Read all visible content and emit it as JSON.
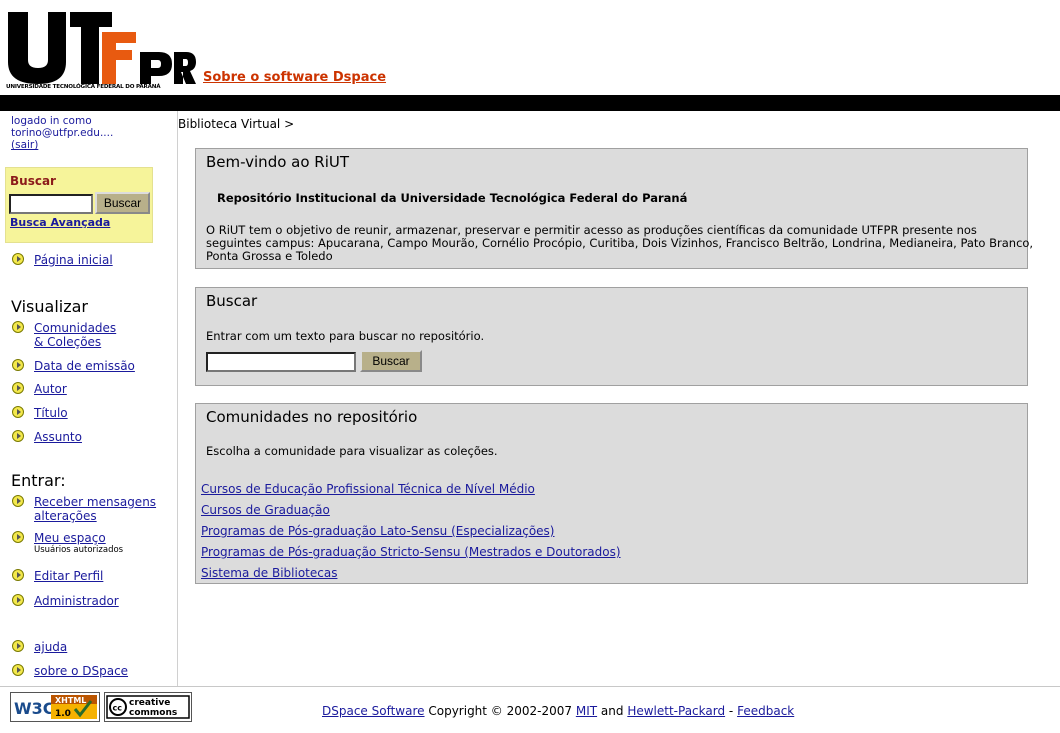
{
  "header": {
    "logo_text": "UTFPR",
    "logo_subtitle": "UNIVERSIDADE TECNOLÓGICA FEDERAL DO PARANÁ",
    "about_link": "Sobre o software Dspace"
  },
  "sidebar": {
    "login_line1": "logado in como",
    "login_line2": "torino@utfpr.edu....",
    "logout": "(sair)",
    "search_title": "Buscar",
    "search_button": "Buscar",
    "search_value": "",
    "advanced_search": "Busca Avançada",
    "home": "Página inicial",
    "browse_title": "Visualizar",
    "browse_items": [
      "Comunidades",
      "& Coleções",
      "Data de emissão",
      "Autor",
      "Título",
      "Assunto"
    ],
    "login_title": "Entrar:",
    "receive_1": "Receber mensagens",
    "receive_2": "alterações",
    "myspace": "Meu espaço",
    "myspace_note": "Usuários autorizados",
    "edit_profile": "Editar Perfil",
    "admin": "Administrador",
    "help": "ajuda",
    "about_dspace": "sobre o DSpace"
  },
  "main": {
    "breadcrumb": "Biblioteca Virtual >",
    "welcome_title": "Bem-vindo ao RiUT",
    "welcome_subtitle": "Repositório Institucional da Universidade Tecnológica Federal do Paraná",
    "welcome_text": "O RiUT tem o objetivo de reunir, armazenar, preservar e permitir acesso as produções científicas da comunidade UTFPR presente nos seguintes campus: Apucarana, Campo Mourão, Cornélio Procópio, Curitiba, Dois Vizinhos, Francisco Beltrão, Londrina, Medianeira, Pato Branco, Ponta Grossa e Toledo",
    "search_title": "Buscar",
    "search_text": "Entrar com um texto para buscar no repositório.",
    "search_button": "Buscar",
    "search_value": "",
    "communities_title": "Comunidades no repositório",
    "communities_text": "Escolha a comunidade para visualizar as coleções.",
    "communities": [
      "Cursos de Educação Profissional Técnica de Nível Médio",
      "Cursos de Graduação",
      "Programas de Pós-graduação Lato-Sensu (Especializações)",
      "Programas de Pós-graduação Stricto-Sensu (Mestrados e Doutorados)",
      "Sistema de Bibliotecas"
    ]
  },
  "footer": {
    "w3c_badge": "W3C XHTML 1.0",
    "cc_badge": "creative commons",
    "dspace": "DSpace Software",
    "copyright": "Copyright © 2002-2007",
    "mit": "MIT",
    "and": "and",
    "hp": "Hewlett-Packard",
    "dash": "-",
    "feedback": "Feedback"
  },
  "colors": {
    "link": "#1a1a9c",
    "panel_bg": "#dcdcdc",
    "search_box_bg": "#f6f49a",
    "about_link": "#cc3300",
    "top_bar": "#000000"
  }
}
